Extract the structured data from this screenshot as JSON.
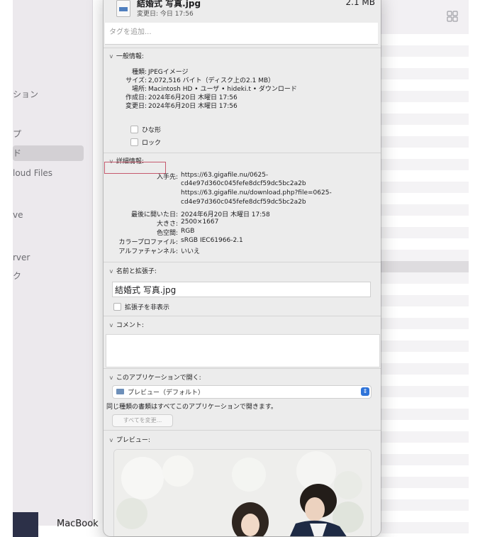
{
  "sidebar": {
    "items": [
      {
        "label": "ション"
      },
      {
        "label": "プ"
      },
      {
        "label": "ド"
      },
      {
        "label": "loud Files"
      },
      {
        "label": "ve"
      },
      {
        "label": "rver"
      },
      {
        "label": "ク"
      }
    ],
    "device_label": "MacBook"
  },
  "info": {
    "file_name": "結婚式 写真.jpg",
    "file_size": "2.1 MB",
    "modified": "変更日: 今日 17:56",
    "tag_placeholder": "タグを追加...",
    "general": {
      "title": "一般情報:",
      "rows": [
        {
          "label": "種類:",
          "value": "JPEGイメージ"
        },
        {
          "label": "サイズ:",
          "value": "2,072,516 バイト（ディスク上の2.1 MB）"
        },
        {
          "label": "場所:",
          "value": "Macintosh HD • ユーザ • hideki.t • ダウンロード"
        },
        {
          "label": "作成日:",
          "value": "2024年6月20日 木曜日 17:56"
        },
        {
          "label": "変更日:",
          "value": "2024年6月20日 木曜日 17:56"
        }
      ],
      "checkbox_stationery": "ひな形",
      "checkbox_locked": "ロック"
    },
    "details": {
      "title": "詳細情報:",
      "where_from_label": "入手先:",
      "where_from_lines": [
        "https://63.gigafile.nu/0625-",
        "cd4e97d360c045fefe8dcf59dc5bc2a2b",
        "https://63.gigafile.nu/download.php?file=0625-",
        "cd4e97d360c045fefe8dcf59dc5bc2a2b"
      ],
      "rows": [
        {
          "label": "最後に開いた日:",
          "value": "2024年6月20日 木曜日 17:58"
        },
        {
          "label": "大きさ:",
          "value": "2500×1667"
        },
        {
          "label": "色空間:",
          "value": "RGB"
        },
        {
          "label": "カラープロファイル:",
          "value": "sRGB IEC61966-2.1"
        },
        {
          "label": "アルファチャンネル:",
          "value": "いいえ"
        }
      ]
    },
    "name_ext": {
      "title": "名前と拡張子:",
      "value": "結婚式 写真.jpg",
      "hide_ext": "拡張子を非表示"
    },
    "comments": {
      "title": "コメント:"
    },
    "open_with": {
      "title": "このアプリケーションで開く:",
      "app": "プレビュー（デフォルト）",
      "note": "同じ種類の書類はすべてこのアプリケーションで開きます。",
      "change_all": "すべてを変更..."
    },
    "preview": {
      "title": "プレビュー:"
    }
  },
  "colors": {
    "panel_bg": "#ececec",
    "accent": "#2f74d9",
    "highlight_box": "#c65a6e"
  }
}
